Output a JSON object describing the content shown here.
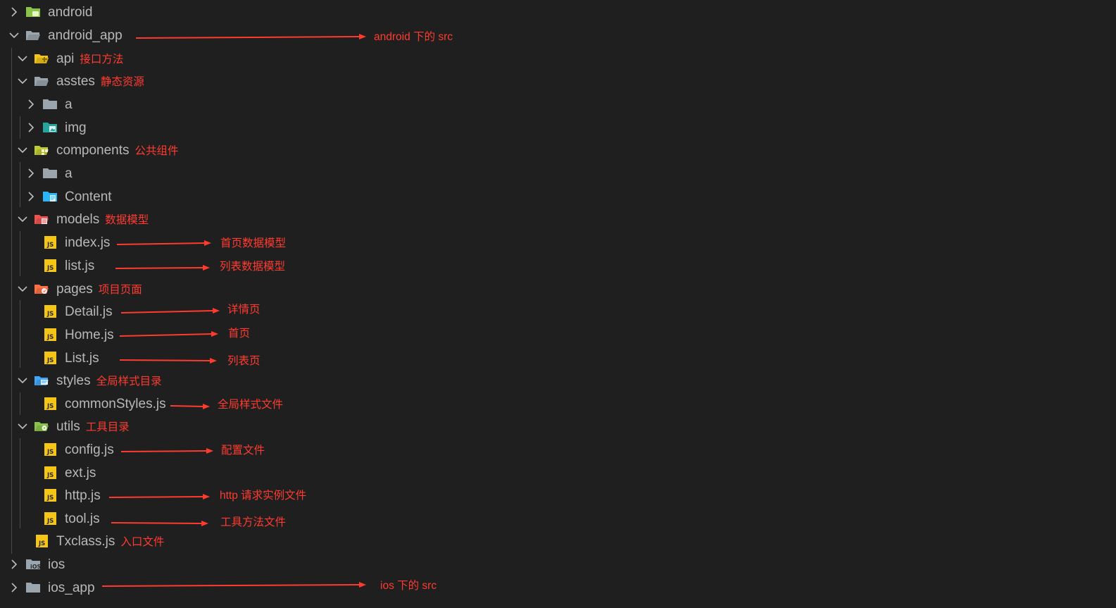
{
  "colors": {
    "background": "#1f1f1f",
    "text": "#b8b8b8",
    "annotation": "#ff3b30",
    "js_badge": "#f5c518"
  },
  "tree": [
    {
      "label": "android",
      "note": "",
      "icon": "android-folder-icon",
      "expanded": false
    },
    {
      "label": "android_app",
      "note": "",
      "icon": "folder-open-icon",
      "expanded": true
    },
    {
      "label": "api",
      "note": "接口方法",
      "icon": "api-folder-icon",
      "expanded": true
    },
    {
      "label": "asstes",
      "note": "静态资源",
      "icon": "folder-open-icon",
      "expanded": true
    },
    {
      "label": "a",
      "note": "",
      "icon": "folder-icon",
      "expanded": false
    },
    {
      "label": "img",
      "note": "",
      "icon": "image-folder-icon",
      "expanded": false
    },
    {
      "label": "components",
      "note": "公共组件",
      "icon": "components-folder-icon",
      "expanded": true
    },
    {
      "label": "a",
      "note": "",
      "icon": "folder-icon",
      "expanded": false
    },
    {
      "label": "Content",
      "note": "",
      "icon": "content-folder-icon",
      "expanded": false
    },
    {
      "label": "models",
      "note": "数据模型",
      "icon": "models-folder-icon",
      "expanded": true
    },
    {
      "label": "index.js",
      "note": "",
      "icon": "js-file-icon"
    },
    {
      "label": "list.js",
      "note": "",
      "icon": "js-file-icon"
    },
    {
      "label": "pages",
      "note": "项目页面",
      "icon": "pages-folder-icon",
      "expanded": true
    },
    {
      "label": "Detail.js",
      "note": "",
      "icon": "js-file-icon"
    },
    {
      "label": "Home.js",
      "note": "",
      "icon": "js-file-icon"
    },
    {
      "label": "List.js",
      "note": "",
      "icon": "js-file-icon"
    },
    {
      "label": "styles",
      "note": "全局样式目录",
      "icon": "styles-folder-icon",
      "expanded": true
    },
    {
      "label": "commonStyles.js",
      "note": "",
      "icon": "js-file-icon"
    },
    {
      "label": "utils",
      "note": "工具目录",
      "icon": "utils-folder-icon",
      "expanded": true
    },
    {
      "label": "config.js",
      "note": "",
      "icon": "js-file-icon"
    },
    {
      "label": "ext.js",
      "note": "",
      "icon": "js-file-icon"
    },
    {
      "label": "http.js",
      "note": "",
      "icon": "js-file-icon"
    },
    {
      "label": "tool.js",
      "note": "",
      "icon": "js-file-icon"
    },
    {
      "label": "Txclass.js",
      "note": "入口文件",
      "icon": "js-file-icon"
    },
    {
      "label": "ios",
      "note": "",
      "icon": "ios-folder-icon",
      "expanded": false
    },
    {
      "label": "ios_app",
      "note": "",
      "icon": "folder-icon",
      "expanded": false
    }
  ],
  "annotations": [
    {
      "text": "android 下的 src"
    },
    {
      "text": "首页数据模型"
    },
    {
      "text": "列表数据模型"
    },
    {
      "text": "详情页"
    },
    {
      "text": "首页"
    },
    {
      "text": "列表页"
    },
    {
      "text": "全局样式文件"
    },
    {
      "text": "配置文件"
    },
    {
      "text": "http 请求实例文件"
    },
    {
      "text": "工具方法文件"
    },
    {
      "text": "ios 下的 src"
    }
  ]
}
